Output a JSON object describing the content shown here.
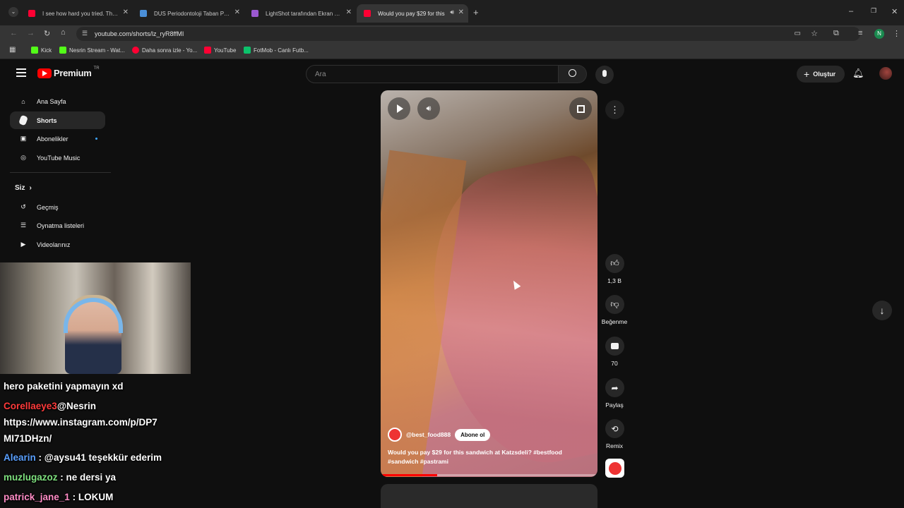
{
  "browser": {
    "tabs": [
      {
        "label": "I see how hard you tried. That m",
        "favicon_color": "#ff0033"
      },
      {
        "label": "DUS Periodontoloji Taban Puan...",
        "favicon_color": "#4a8fd8"
      },
      {
        "label": "LightShot tarafından Ekran Gör...",
        "favicon_color": "#9b59d0"
      },
      {
        "label": "Would you pay $29 for this",
        "favicon_color": "#ff0033"
      }
    ],
    "url": "youtube.com/shorts/lz_ryR8ffMI",
    "bookmarks": [
      {
        "label": "Kick",
        "color": "#53fc18"
      },
      {
        "label": "Nesrin Stream - Wat...",
        "color": "#53fc18"
      },
      {
        "label": "Daha sonra izle - Yo...",
        "color": "#ff0033"
      },
      {
        "label": "YouTube",
        "color": "#ff0033"
      },
      {
        "label": "FotMob - Canlı Futb...",
        "color": "#0cc26b"
      }
    ],
    "profile_initial": "N"
  },
  "youtube": {
    "logo_text": "Premium",
    "logo_badge": "TR",
    "search_placeholder": "Ara",
    "create_label": "Oluştur",
    "sidebar": {
      "items": [
        {
          "label": "Ana Sayfa",
          "icon": "home-icon"
        },
        {
          "label": "Shorts",
          "icon": "shorts-icon"
        },
        {
          "label": "Abonelikler",
          "icon": "subscriptions-icon"
        },
        {
          "label": "YouTube Music",
          "icon": "music-icon"
        }
      ],
      "you_heading": "Siz",
      "you_items": [
        {
          "label": "Geçmiş",
          "icon": "history-icon"
        },
        {
          "label": "Oynatma listeleri",
          "icon": "playlist-icon"
        },
        {
          "label": "Videolarınız",
          "icon": "your-videos-icon"
        }
      ]
    },
    "short": {
      "channel": "@best_food888",
      "subscribe_label": "Abone ol",
      "caption_line1": "Would you pay $29 for this sandwich at Katzsdeli? #bestfood",
      "caption_line2": "#sandwich #pastrami",
      "progress_percent": 26
    },
    "actions": {
      "like_count": "1,3 B",
      "dislike_label": "Beğenme",
      "comment_count": "70",
      "share_label": "Paylaş",
      "remix_label": "Remix"
    }
  },
  "chat": [
    {
      "user": "",
      "message": "hero paketini yapmayın xd",
      "color": "#ffffff"
    },
    {
      "user": "Corellaeye3",
      "message": "@Nesrin",
      "color": "#ff3b3b"
    },
    {
      "user": "",
      "message": "https://www.instagram.com/p/DP7",
      "color": "#ffffff"
    },
    {
      "user": "",
      "message": "MI71DHzn/",
      "color": "#ffffff"
    },
    {
      "user": "Alearin",
      "message": ": @aysu41 teşekkür ederim",
      "color": "#5aa0ff"
    },
    {
      "user": "muzlugazoz",
      "message": ": ne dersi ya",
      "color": "#7ee07e"
    },
    {
      "user": "patrick_jane_1",
      "message": ": LOKUM",
      "color": "#ff8cc6"
    }
  ],
  "colors": {
    "brand_red": "#ff0000",
    "page_bg": "#0f0f0f"
  }
}
